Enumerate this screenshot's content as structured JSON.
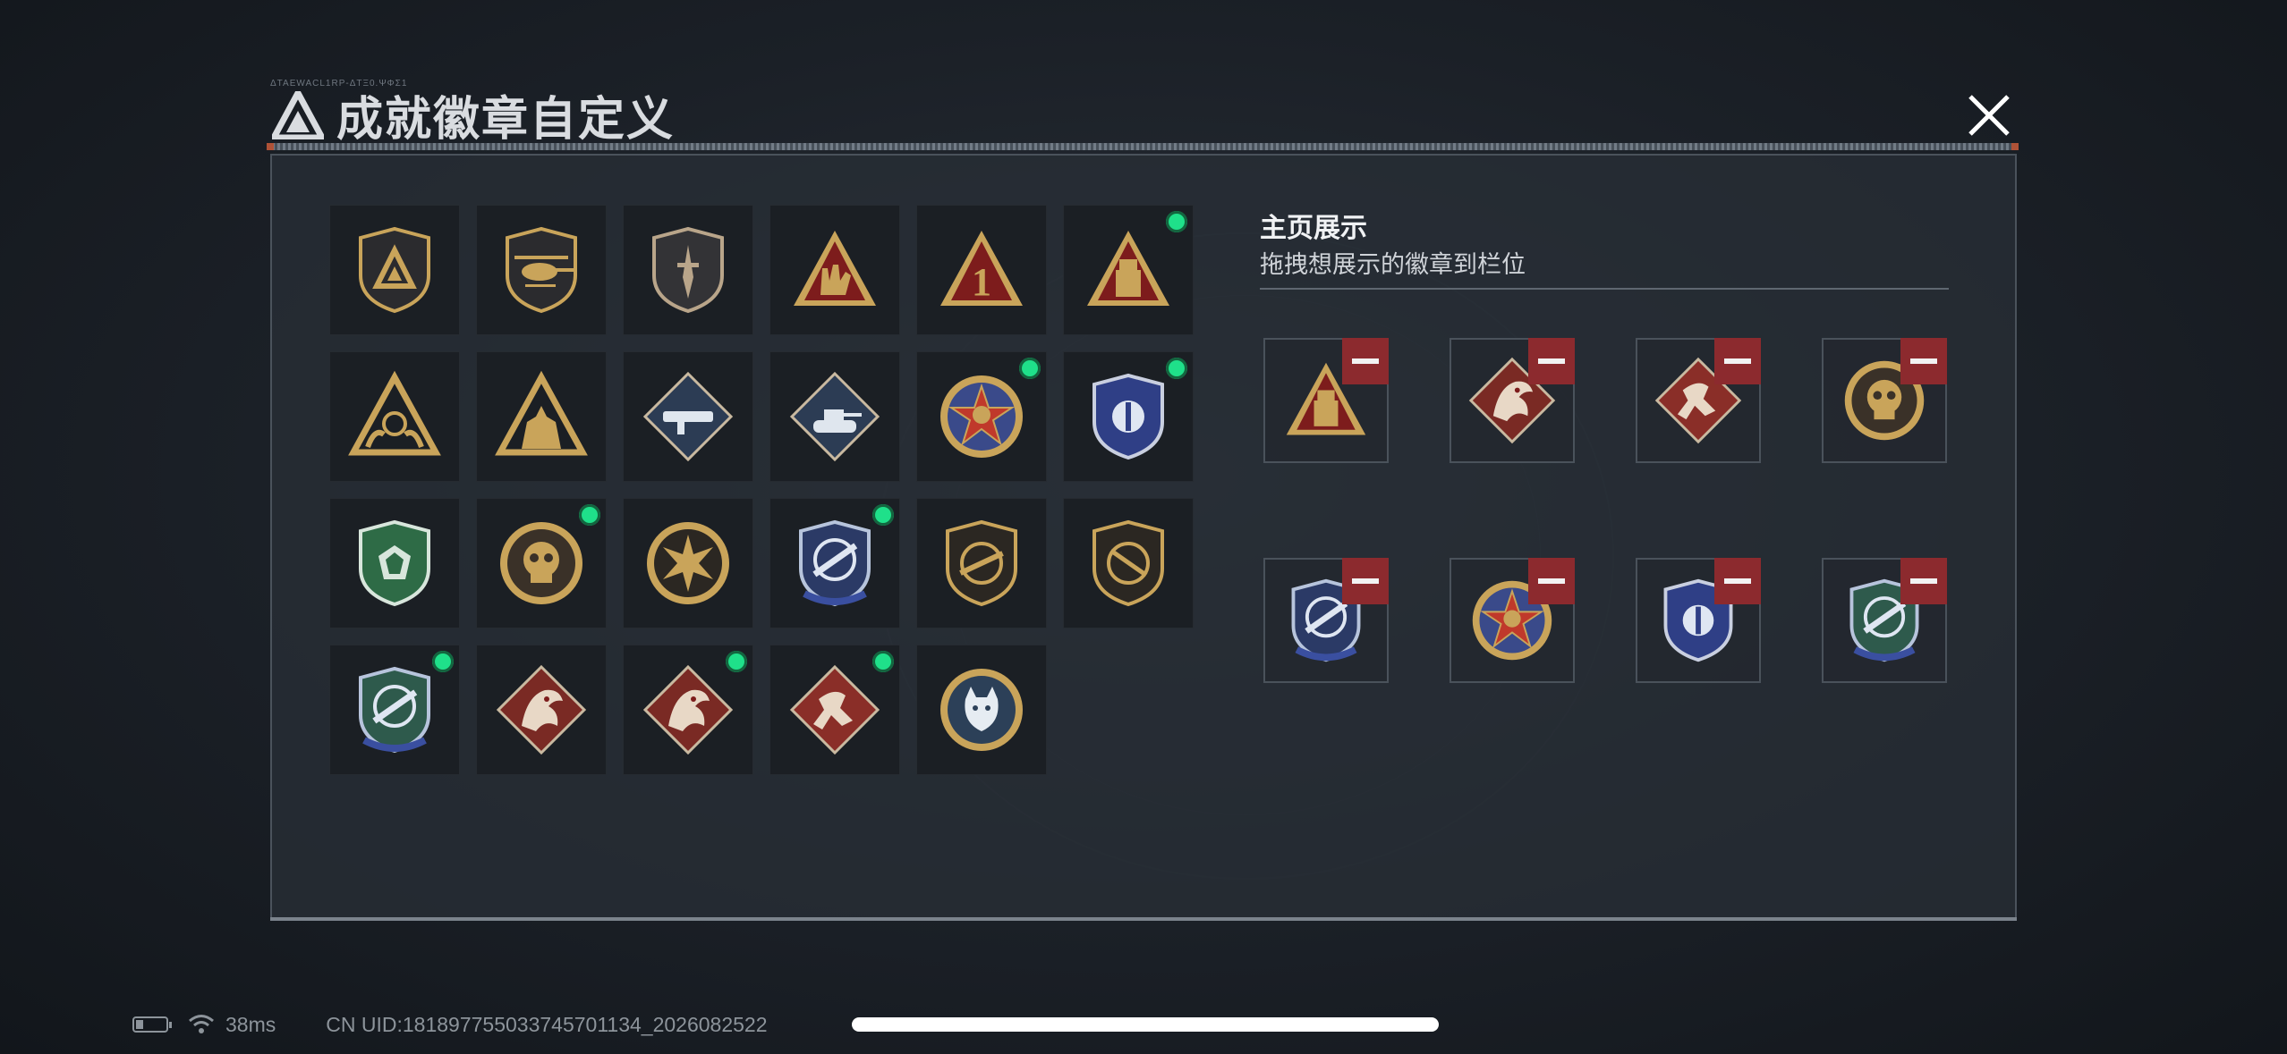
{
  "dialog": {
    "title": "成就徽章自定义",
    "header_tiny_text": "ΔTAEWACL1RP-ΔTΞ0.ΨΦΣ1"
  },
  "showcase": {
    "title": "主页展示",
    "subtitle": "拖拽想展示的徽章到栏位"
  },
  "badges": [
    {
      "name": "triangle-shield-badge",
      "new": false
    },
    {
      "name": "helicopter-shield-badge",
      "new": false
    },
    {
      "name": "dagger-shield-badge",
      "new": false
    },
    {
      "name": "hand-sign-triangle-badge",
      "new": false
    },
    {
      "name": "number-one-triangle-badge",
      "new": false
    },
    {
      "name": "usb-triangle-badge",
      "new": true
    },
    {
      "name": "hands-triangle-badge",
      "new": false
    },
    {
      "name": "soldiers-triangle-badge",
      "new": false
    },
    {
      "name": "rocket-diamond-badge",
      "new": false
    },
    {
      "name": "tank-diamond-badge",
      "new": false
    },
    {
      "name": "star-circle-badge",
      "new": true
    },
    {
      "name": "blue-shield-badge",
      "new": true
    },
    {
      "name": "green-gem-shield-badge",
      "new": false
    },
    {
      "name": "skull-circle-badge",
      "new": true
    },
    {
      "name": "sunburst-circle-badge",
      "new": false
    },
    {
      "name": "blue-crosshair-rifle-badge",
      "new": true
    },
    {
      "name": "gold-rifle-shield-badge",
      "new": false
    },
    {
      "name": "gold-blade-shield-badge",
      "new": false
    },
    {
      "name": "green-crosshair-badge",
      "new": true
    },
    {
      "name": "dragon-diamond-badge",
      "new": false
    },
    {
      "name": "dragon-diamond-badge-2",
      "new": true
    },
    {
      "name": "runner-diamond-badge",
      "new": true
    },
    {
      "name": "lynx-circle-badge",
      "new": false
    }
  ],
  "slots": [
    "usb-triangle-badge",
    "dragon-diamond-badge",
    "runner-diamond-badge",
    "skull-circle-badge",
    "blue-crosshair-rifle-badge",
    "star-circle-badge",
    "blue-shield-badge",
    "green-crosshair-badge"
  ],
  "status_bar": {
    "ping": "38ms",
    "uid": "CN UID:18189775503374570​1134_2026082522"
  },
  "colors": {
    "gold": "#c9a45a",
    "red_triangle": "#7d1c1c",
    "new_dot": "#1fe08a",
    "remove_button": "#8c2a2e"
  }
}
